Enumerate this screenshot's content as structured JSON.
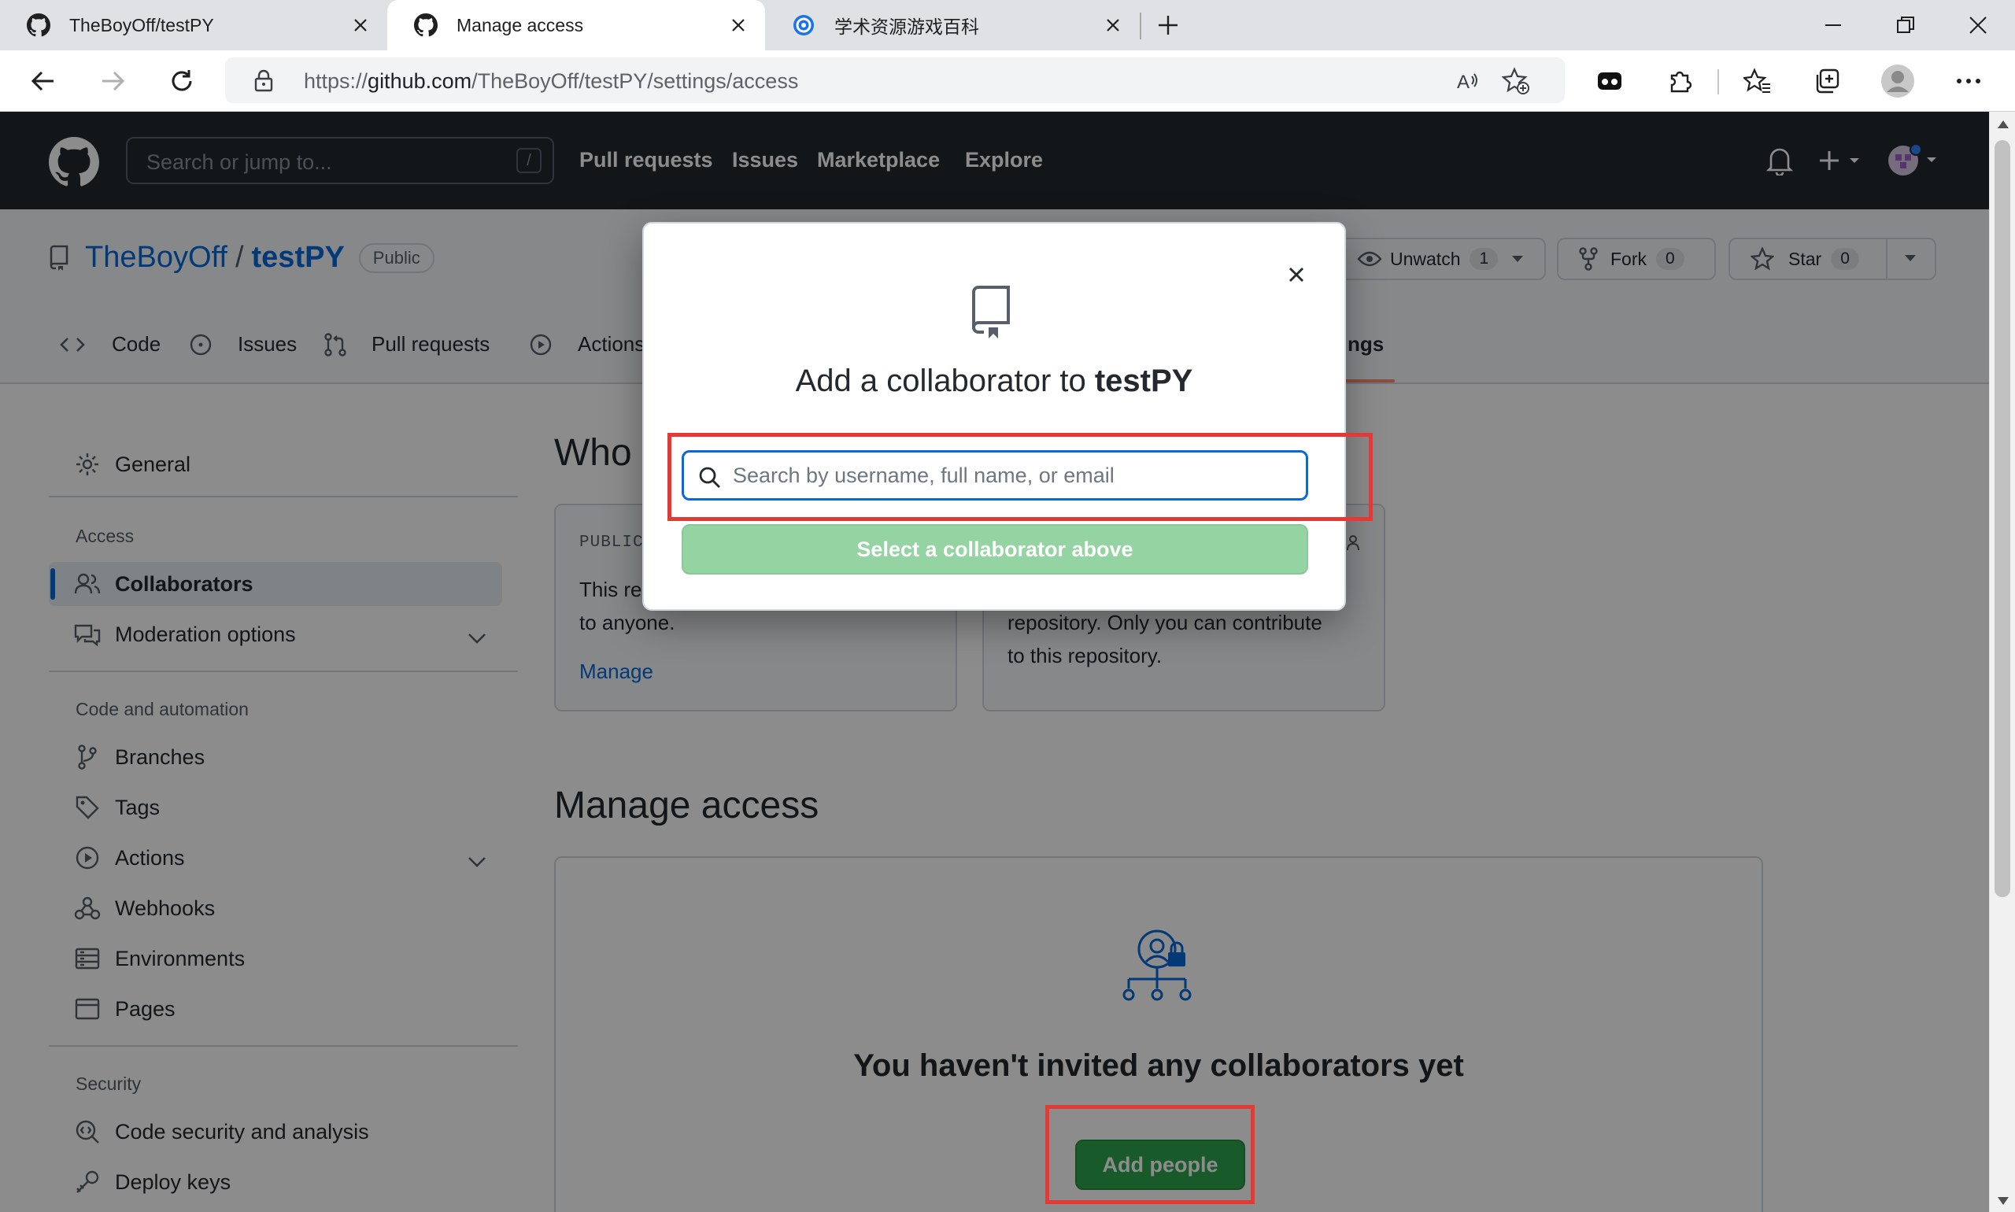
{
  "browser": {
    "tabs": [
      {
        "title": "TheBoyOff/testPY",
        "favicon": "github-icon"
      },
      {
        "title": "Manage access",
        "favicon": "github-icon"
      },
      {
        "title": "学术资源游戏百科",
        "favicon": "globe-icon"
      }
    ],
    "url_prefix": "https://",
    "url_host": "github.com",
    "url_path": "/TheBoyOff/testPY/settings/access"
  },
  "github_header": {
    "search_placeholder": "Search or jump to...",
    "search_shortcut": "/",
    "nav": [
      "Pull requests",
      "Issues",
      "Marketplace",
      "Explore"
    ]
  },
  "repo": {
    "owner": "TheBoyOff",
    "name": "testPY",
    "visibility": "Public",
    "unwatch_label": "Unwatch",
    "unwatch_count": "1",
    "fork_label": "Fork",
    "fork_count": "0",
    "star_label": "Star",
    "star_count": "0",
    "tabs": [
      "Code",
      "Issues",
      "Pull requests",
      "Actions"
    ],
    "settings_tab_fragment": "ngs"
  },
  "sidebar": {
    "general": "General",
    "access_heading": "Access",
    "collaborators": "Collaborators",
    "moderation": "Moderation options",
    "code_heading": "Code and automation",
    "branches": "Branches",
    "tags": "Tags",
    "actions": "Actions",
    "webhooks": "Webhooks",
    "environments": "Environments",
    "pages": "Pages",
    "security_heading": "Security",
    "code_security": "Code security and analysis",
    "deploy_keys": "Deploy keys"
  },
  "main": {
    "who_heading": "Who",
    "public_card_label": "PUBLIC",
    "public_card_text1": "This re",
    "public_card_text2": "to anyone.",
    "public_card_link": "Manage",
    "private_card_text1": "repository. Only you can contribute",
    "private_card_text2": "to this repository.",
    "manage_heading": "Manage access",
    "empty_title": "You haven't invited any collaborators yet",
    "add_people": "Add people"
  },
  "dialog": {
    "title_prefix": "Add a collaborator to ",
    "title_repo": "testPY",
    "search_placeholder": "Search by username, full name, or email",
    "select_button": "Select a collaborator above"
  },
  "colors": {
    "highlight": "#e53935",
    "primary_green": "#2da44e",
    "link_blue": "#0969da"
  }
}
